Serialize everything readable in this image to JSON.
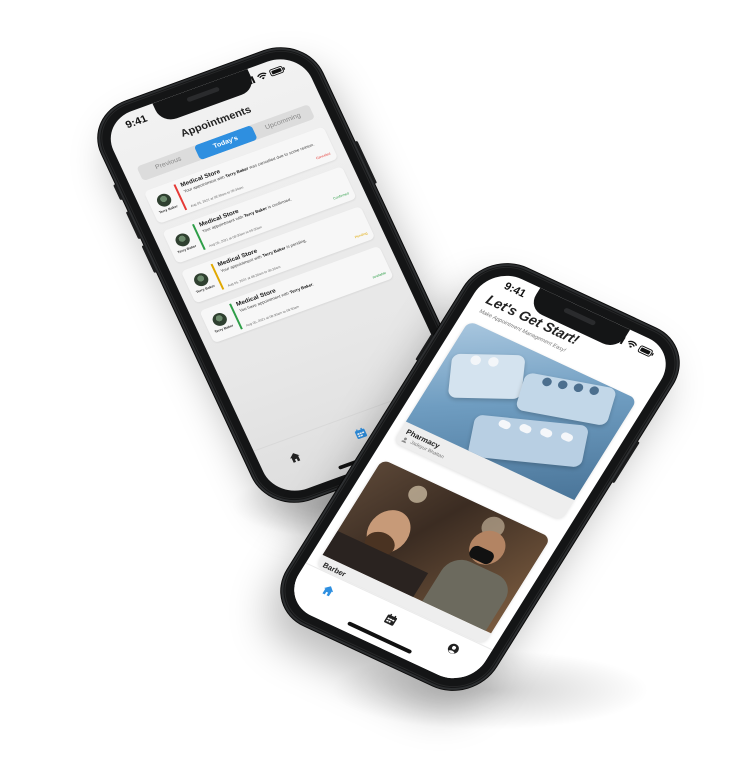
{
  "phone1": {
    "status_time": "9:41",
    "title": "Appointments",
    "tabs": [
      {
        "label": "Previous",
        "active": false
      },
      {
        "label": "Today's",
        "active": true
      },
      {
        "label": "Upcomming",
        "active": false
      }
    ],
    "cards": [
      {
        "store": "Medical Store",
        "person": "Terry Baker",
        "msg_pre": "Your appointment with ",
        "msg_name": "Terry Baker",
        "msg_post": " was cancelled due to some reason.",
        "date": "Aug 05, 2021 at 08:30am to 09:30am",
        "status": "Canceled",
        "status_color": "#e53935"
      },
      {
        "store": "Medical Store",
        "person": "Terry Baker",
        "msg_pre": "Your appointment with ",
        "msg_name": "Terry Baker",
        "msg_post": " is confirmed.",
        "date": "Aug 05, 2021 at 08:30am to 09:30am",
        "status": "Confirmed",
        "status_color": "#2e9e48"
      },
      {
        "store": "Medical Store",
        "person": "Terry Baker",
        "msg_pre": "Your appointment with ",
        "msg_name": "Terry Baker",
        "msg_post": " is pending.",
        "date": "Aug 05, 2021 at 08:30am to 09:30am",
        "status": "Pending",
        "status_color": "#e0a800"
      },
      {
        "store": "Medical Store",
        "person": "Terry Baker",
        "msg_pre": "You have appointment with ",
        "msg_name": "Terry Baker",
        "msg_post": ".",
        "date": "Aug 05, 2021 at 08:30am to 09:30am",
        "status": "available",
        "status_color": "#2e9e48"
      }
    ],
    "nav": [
      {
        "icon": "home-icon",
        "active": false
      },
      {
        "icon": "calendar-icon",
        "active": true
      },
      {
        "icon": "profile-icon",
        "active": false
      }
    ],
    "accent": "#2e8fe0"
  },
  "phone2": {
    "status_time": "9:41",
    "title": "Let's Get Start!",
    "subtitle": "Make Appointment Management Easy!",
    "services": [
      {
        "label": "Pharmacy",
        "owner": "Jadeyur Bhattan"
      },
      {
        "label": "Barber",
        "owner": ""
      }
    ],
    "nav": [
      {
        "icon": "home-icon",
        "active": true
      },
      {
        "icon": "calendar-icon",
        "active": false
      },
      {
        "icon": "profile-icon",
        "active": false
      }
    ]
  }
}
